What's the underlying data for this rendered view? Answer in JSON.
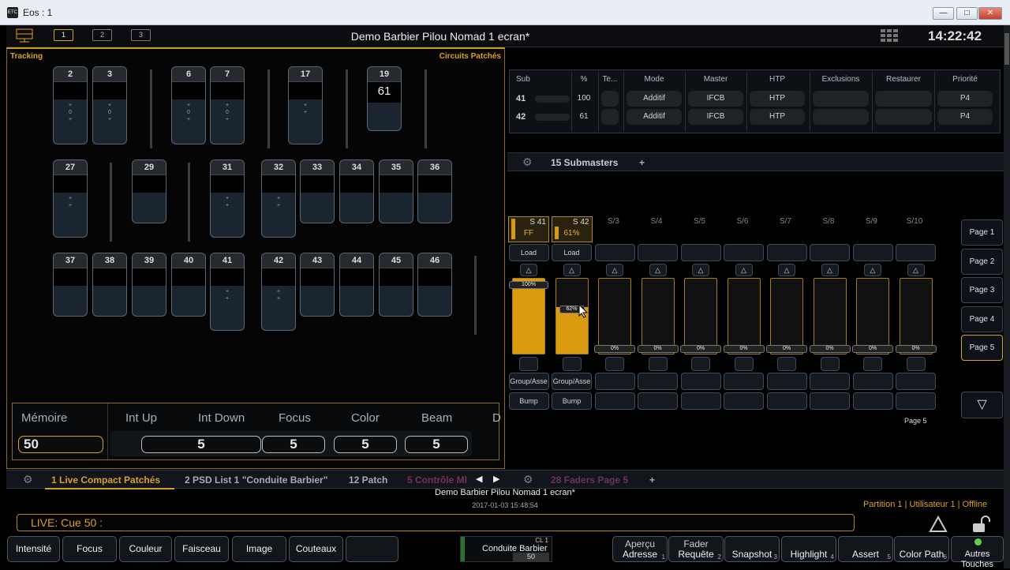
{
  "window": {
    "title": "Eos : 1",
    "app_icon": "ETC"
  },
  "topbar": {
    "selectors": [
      "1",
      "2",
      "3"
    ],
    "show_title": "Demo Barbier Pilou Nomad 1 ecran*",
    "clock": "14:22:42"
  },
  "left": {
    "title_left": "Tracking",
    "title_right": "Circuits Patchés",
    "row1": [
      {
        "n": "2",
        "d": "+ 0 +"
      },
      {
        "n": "3",
        "d": "+ 0 +"
      },
      {
        "n": "6",
        "d": "+ 0 +"
      },
      {
        "n": "7",
        "d": "+ 0 +"
      },
      {
        "n": "17",
        "d": "+ +"
      },
      {
        "n": "19",
        "v": "61"
      }
    ],
    "row2": [
      {
        "n": "27",
        "d": "+ +"
      },
      {
        "n": "29"
      },
      {
        "n": "31",
        "d": "+ +"
      },
      {
        "n": "32",
        "d": "+ +"
      },
      {
        "n": "33"
      },
      {
        "n": "34"
      },
      {
        "n": "35"
      },
      {
        "n": "36"
      }
    ],
    "row3": [
      {
        "n": "37"
      },
      {
        "n": "38"
      },
      {
        "n": "39"
      },
      {
        "n": "40"
      },
      {
        "n": "41",
        "d": "+ +"
      },
      {
        "n": "42",
        "d": "+ +"
      },
      {
        "n": "43"
      },
      {
        "n": "44"
      },
      {
        "n": "45"
      },
      {
        "n": "46"
      }
    ]
  },
  "params": {
    "memoire_label": "Mémoire",
    "memoire_value": "50",
    "labels": [
      "Int Up",
      "Int Down",
      "Focus",
      "Color",
      "Beam",
      "D"
    ],
    "int_value": "5",
    "focus_value": "5",
    "color_value": "5",
    "beam_value": "5"
  },
  "subtable": {
    "headers": [
      "Sub",
      "%",
      "Te...",
      "Mode",
      "Master",
      "HTP",
      "Exclusions",
      "Restaurer",
      "Priorité"
    ],
    "rows": [
      {
        "sub": "41",
        "pct": "100",
        "mode": "Additif",
        "master": "IFCB",
        "htp": "HTP",
        "prio": "P4"
      },
      {
        "sub": "42",
        "pct": "61",
        "mode": "Additif",
        "master": "IFCB",
        "htp": "HTP",
        "prio": "P4"
      }
    ]
  },
  "subtabs": {
    "tab": "15 Submasters",
    "plus": "+"
  },
  "faders": {
    "heads": [
      {
        "s": "S 41",
        "v": "FF"
      },
      {
        "s": "S 42",
        "v": "61%"
      },
      {
        "s": "S/3"
      },
      {
        "s": "S/4"
      },
      {
        "s": "S/5"
      },
      {
        "s": "S/6"
      },
      {
        "s": "S/7"
      },
      {
        "s": "S/8"
      },
      {
        "s": "S/9"
      },
      {
        "s": "S/10"
      }
    ],
    "levels": [
      1.0,
      0.62,
      0,
      0,
      0,
      0,
      0,
      0,
      0,
      0
    ],
    "load_label": "Load",
    "up_label": "△",
    "group_label": "Group/Asse",
    "bump_label": "Bump",
    "lab100": "100%",
    "lab62": "62%",
    "lab0": "0%",
    "page_buttons": [
      "Page 1",
      "Page 2",
      "Page 3",
      "Page 4",
      "Page 5"
    ],
    "page_indicator": "Page 5",
    "down_arrow": "▽"
  },
  "tabs": {
    "left": [
      "1 Live Compact Patchés",
      "2 PSD List 1 \"Conduite Barbier\"",
      "12 Patch",
      "5 Contrôle Ml"
    ],
    "right": "28 Faders Page 5",
    "plus": "+"
  },
  "status": {
    "show": "Demo Barbier Pilou Nomad 1 ecran*",
    "date": "2017-01-03 15:48:54",
    "partition": "Partition 1 | Utilisateur 1 | Offline",
    "cmd": "LIVE: Cue  50 :"
  },
  "softkeys": {
    "left": [
      "Intensité",
      "Focus",
      "Couleur",
      "Faisceau",
      "Image",
      "Couteaux",
      ""
    ],
    "cue": {
      "cl": "CL 1",
      "name": "Conduite Barbier",
      "val": "50"
    },
    "right": [
      {
        "a": "Aperçu",
        "b": "Adresse",
        "fn": "1"
      },
      {
        "a": "Fader",
        "b": "Requête",
        "fn": "2"
      },
      {
        "a": "",
        "b": "Snapshot",
        "fn": "3"
      },
      {
        "a": "",
        "b": "Highlight",
        "fn": "4"
      },
      {
        "a": "",
        "b": "Assert",
        "fn": "5"
      },
      {
        "a": "",
        "b": "Color Path",
        "fn": "6"
      },
      {
        "a": "",
        "b": "Autres Touches",
        "fn": ""
      }
    ]
  },
  "colors": {
    "accent": "#d9a028",
    "fader_fill": "#d99a10"
  }
}
